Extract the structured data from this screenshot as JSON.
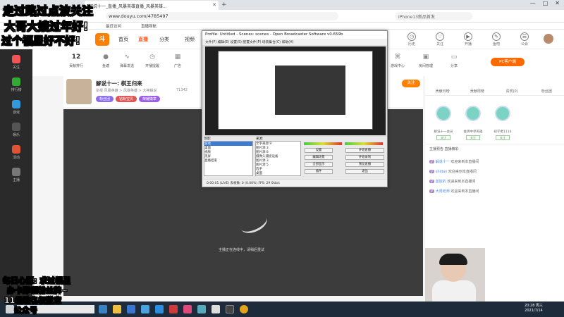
{
  "browser": {
    "tab_title": "解说十一_直播_风暴英雄直播_风暴英雄...",
    "url": "www.douyu.com/4785497",
    "search_placeholder": "iPhone13新品首发",
    "bookmarks": [
      "最近访问",
      "直播导航"
    ],
    "window_controls": [
      "—",
      "□",
      "✕"
    ]
  },
  "site": {
    "logo": "斗",
    "nav": [
      "首页",
      "直播",
      "分类",
      "视频"
    ],
    "top_icons": [
      {
        "name": "history-icon",
        "label": "历史"
      },
      {
        "name": "follow-icon",
        "label": "关注"
      },
      {
        "name": "live-icon",
        "label": "开播"
      },
      {
        "name": "creator-icon",
        "label": "鱼吧"
      },
      {
        "name": "guild-icon",
        "label": "公会"
      }
    ],
    "left_nav": [
      "关注",
      "排行榜",
      "游戏",
      "娱乐",
      "活动",
      "主播"
    ],
    "gift_bar": [
      {
        "icon": "fish-icon",
        "label": "贡献排行",
        "value": "12"
      },
      {
        "icon": "team-icon",
        "label": "鱼塘"
      },
      {
        "icon": "wave-icon",
        "label": "弹幕发送"
      },
      {
        "icon": "clock-icon",
        "label": "开播提醒"
      },
      {
        "icon": "ad-icon",
        "label": "广告"
      },
      {
        "icon": "game-icon",
        "label": "游戏中心"
      },
      {
        "icon": "lock-icon",
        "label": "房间管理"
      },
      {
        "icon": "tv-icon",
        "label": "分享"
      }
    ],
    "pc_button": "PC客户端",
    "room": {
      "title": "解说十一: 棋王归来",
      "meta": "举报  风暴英雄 > 风暴英雄 > 大神解说",
      "fans": "71342",
      "tags": [
        "粉丝团",
        "钻粉宝贝",
        "荣耀徽章"
      ],
      "follow": "关注"
    },
    "player_message": "主播正在连线中，请稍后重试",
    "right_panel": {
      "tabs": [
        "贡献日榜",
        "贡献周榜",
        "贵宾(0)",
        "粉丝团"
      ],
      "ranks": [
        {
          "name": "解说十一会员",
          "btn": "关注"
        },
        {
          "name": "金牌中单英雄",
          "btn": "关注"
        },
        {
          "name": "初学者1114",
          "btn": "关注"
        }
      ],
      "sub_tabs": "主播预告  直播精彩",
      "chat": [
        {
          "user": "解说十一",
          "text": "欢迎来到本直播间"
        },
        {
          "user": "shidan",
          "text": "欢迎来到本直播间"
        },
        {
          "user": "蓝奴的",
          "text": "欢迎来到本直播间"
        },
        {
          "user": "大周老师",
          "text": "欢迎来到本直播间"
        }
      ]
    }
  },
  "obs": {
    "title": "Profile: Untitled - Scenes: scenes - Open Broadcaster Software v0.659b",
    "menu": "文件(F)  编辑(E)  设置(S)  配置文件(P)  场景集合(C)  帮助(H)",
    "scenes_label": "场景:",
    "sources_label": "来源:",
    "scenes": [
      "游戏",
      "桌面",
      "视频",
      "黑屏",
      "直播结束"
    ],
    "sources": [
      "文字来源 9",
      "图片源 3",
      "图片源 8",
      "摄像头捕捉设备",
      "图片源 3",
      "图片源 5",
      "选手",
      "桌面",
      "文字来源 3"
    ],
    "buttons_left": [
      "设置",
      "编辑场景",
      "全部显示",
      "插件"
    ],
    "buttons_right": [
      "开始直播",
      "开始录制",
      "预览直播",
      "退出"
    ],
    "status": "0:00:01  (LIVE)    丢帧数: 0 (0.00%)    FPS: 29    0kb/s"
  },
  "taskbar": {
    "clock_time": "20:28 周三",
    "clock_date": "2021/7/14"
  },
  "overlay": {
    "line1": "走过路过点波关注",
    "line2": "大哥大嫂过年好!",
    "line3": "过个福星好不好!",
    "bottom": [
      "每日心愿: 求过福星",
      "办卡即领粉丝牌~",
      "11级改名权徽章",
      "公众号"
    ]
  },
  "colors": {
    "brand": "#ff7f00",
    "taskbar": "#1d2b3a",
    "obs_select": "#3a7bd5"
  }
}
